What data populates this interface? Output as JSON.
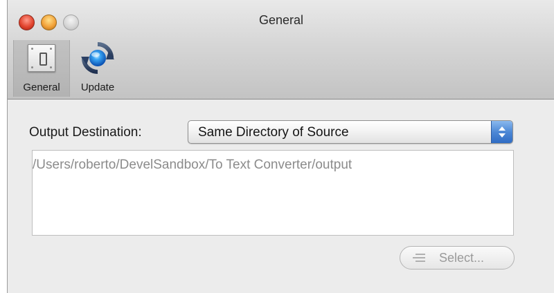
{
  "window": {
    "title": "General"
  },
  "toolbar": {
    "items": [
      {
        "label": "General",
        "icon": "switch-icon",
        "selected": true
      },
      {
        "label": "Update",
        "icon": "refresh-icon",
        "selected": false
      }
    ]
  },
  "form": {
    "output_destination_label": "Output Destination:",
    "output_destination_value": "Same Directory of Source",
    "path_value": "/Users/roberto/DevelSandbox/To Text Converter/output",
    "select_button_label": "Select...",
    "select_button_enabled": false
  },
  "colors": {
    "close": "#e2452f",
    "minimize": "#f2a23a",
    "accent": "#4d88d6"
  }
}
